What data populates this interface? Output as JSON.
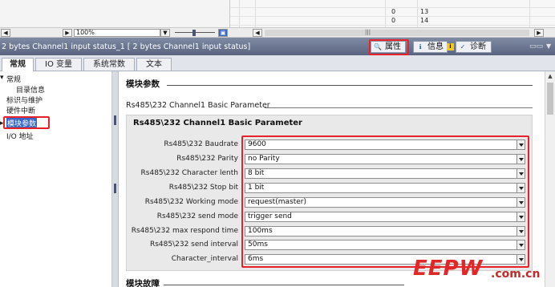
{
  "top_table": {
    "rows": [
      {
        "col1": "",
        "col2": ""
      },
      {
        "col1": "0",
        "col2": "13"
      },
      {
        "col1": "0",
        "col2": "14"
      }
    ]
  },
  "toolbar": {
    "zoom_value": "100%"
  },
  "titlebar": {
    "title": "2 bytes Channel1 input status_1 [ 2 bytes Channel1 input status]",
    "tabs": [
      {
        "label": "属性",
        "icon": "properties-icon"
      },
      {
        "label": "信息",
        "icon": "info-icon"
      },
      {
        "label": "诊断",
        "icon": "diagnostics-icon"
      }
    ]
  },
  "subtabs": [
    "常规",
    "IO 变量",
    "系统常数",
    "文本"
  ],
  "tree": {
    "items": [
      {
        "label": "常规",
        "level": 0
      },
      {
        "label": "目录信息",
        "level": 1
      },
      {
        "label": "标识与维护",
        "level": 0
      },
      {
        "label": "硬件中断",
        "level": 0
      },
      {
        "label": "模块参数",
        "level": 0,
        "selected": true
      },
      {
        "label": "I/O 地址",
        "level": 0
      }
    ]
  },
  "main": {
    "section_title": "模块参数",
    "group_title": "Rs485\\232 Channel1 Basic Parameter",
    "panel_title": "Rs485\\232 Channel1 Basic Parameter",
    "params": [
      {
        "label": "Rs485\\232  Baudrate",
        "value": "9600"
      },
      {
        "label": "Rs485\\232  Parity",
        "value": "no Parity"
      },
      {
        "label": "Rs485\\232  Character lenth",
        "value": "8 bit"
      },
      {
        "label": "Rs485\\232 Stop bit",
        "value": "1 bit"
      },
      {
        "label": "Rs485\\232 Working mode",
        "value": "request(master)"
      },
      {
        "label": "Rs485\\232 send mode",
        "value": "trigger send"
      },
      {
        "label": "Rs485\\232 max respond time",
        "value": "100ms"
      },
      {
        "label": "Rs485\\232 send interval",
        "value": "50ms"
      },
      {
        "label": "Character_interval",
        "value": "6ms"
      }
    ],
    "next_section_title": "模块故障"
  },
  "watermark": {
    "text": "EEPW",
    "sub": ".com.cn"
  },
  "colors": {
    "highlight": "#e8222a",
    "titlebar": "#5a6480",
    "selection": "#3a66c6"
  }
}
